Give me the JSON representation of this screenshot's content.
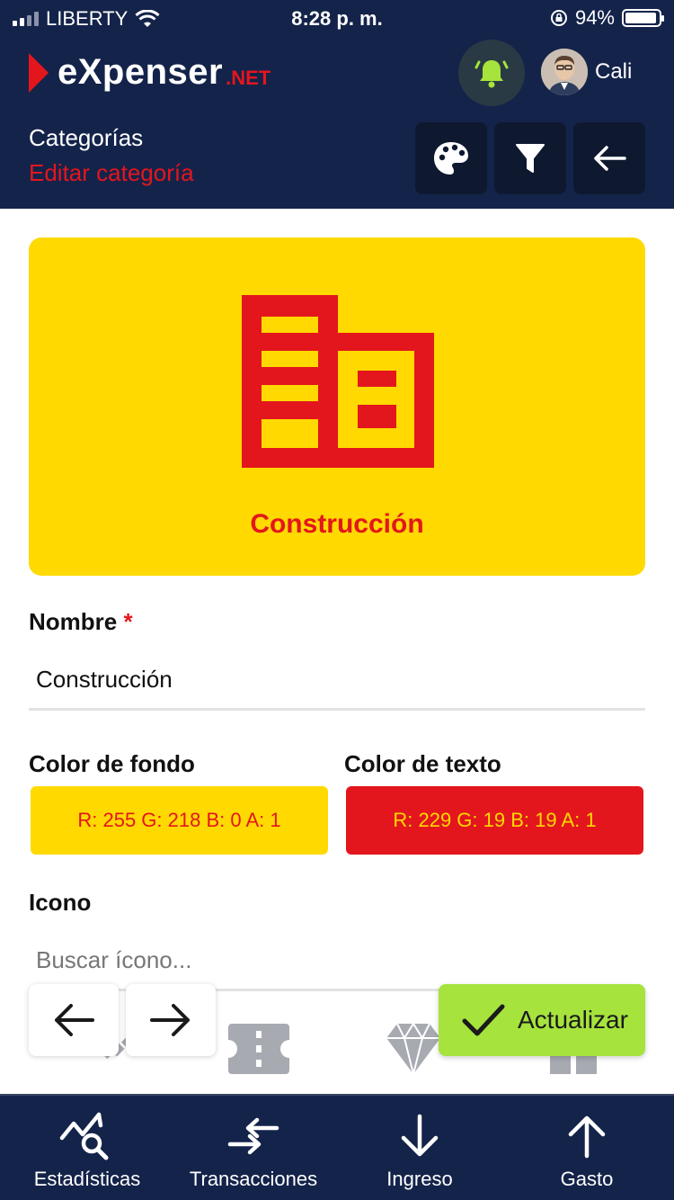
{
  "status_bar": {
    "carrier": "LIBERTY",
    "time": "8:28 p. m.",
    "battery": "94%",
    "battery_level": 0.94
  },
  "header": {
    "brand_name": "eXpenser",
    "brand_suffix": ".NET",
    "user_name": "Cali",
    "breadcrumb_parent": "Categorías",
    "breadcrumb_current": "Editar categoría",
    "accent_color": "#e3161d",
    "bar_color": "#14234a"
  },
  "preview": {
    "category_name": "Construcción",
    "icon": "building-icon",
    "background_color": "#ffd900",
    "text_color": "#e3161d"
  },
  "form": {
    "name_label": "Nombre",
    "required_mark": "*",
    "name_value": "Construcción",
    "bg_color_label": "Color de fondo",
    "bg_color_value": "R: 255 G: 218 B: 0 A: 1",
    "text_color_label": "Color de texto",
    "text_color_value": "R: 229 G: 19 B: 19 A: 1",
    "icon_label": "Icono",
    "icon_search_placeholder": "Buscar ícono...",
    "icon_options": [
      "satellite-icon",
      "ticket-icon",
      "diamond-icon",
      "gift-icon"
    ],
    "update_label": "Actualizar"
  },
  "bottom_nav": [
    {
      "label": "Estadísticas",
      "icon": "stats-search-icon"
    },
    {
      "label": "Transacciones",
      "icon": "transfer-arrows-icon"
    },
    {
      "label": "Ingreso",
      "icon": "arrow-down-icon"
    },
    {
      "label": "Gasto",
      "icon": "arrow-up-icon"
    }
  ]
}
